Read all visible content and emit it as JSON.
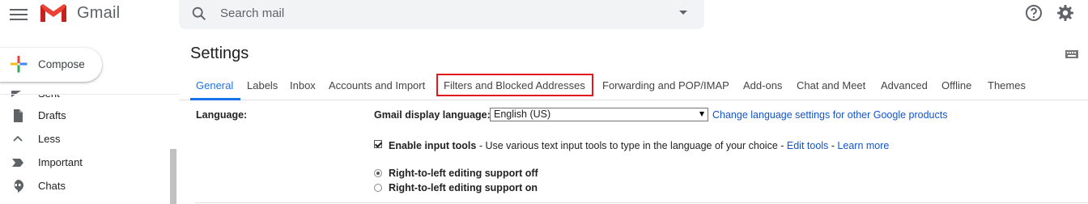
{
  "header": {
    "brand": "Gmail",
    "search_placeholder": "Search mail"
  },
  "sidebar": {
    "compose_label": "Compose",
    "cut_item_label": "Sent",
    "items": [
      {
        "label": "Drafts",
        "icon": "draft-icon"
      },
      {
        "label": "Less",
        "icon": "chevron-up-icon"
      },
      {
        "label": "Important",
        "icon": "important-icon"
      },
      {
        "label": "Chats",
        "icon": "chat-icon"
      }
    ]
  },
  "settings": {
    "title": "Settings",
    "tabs": [
      {
        "label": "General",
        "active": true
      },
      {
        "label": "Labels"
      },
      {
        "label": "Inbox"
      },
      {
        "label": "Accounts and Import"
      },
      {
        "label": "Filters and Blocked Addresses",
        "highlighted": true
      },
      {
        "label": "Forwarding and POP/IMAP"
      },
      {
        "label": "Add-ons"
      },
      {
        "label": "Chat and Meet"
      },
      {
        "label": "Advanced"
      },
      {
        "label": "Offline"
      },
      {
        "label": "Themes"
      }
    ],
    "language": {
      "label": "Language:",
      "display_language_label": "Gmail display language:",
      "selected_language": "English (US)",
      "change_link": "Change language settings for other Google products",
      "input_tools_bold": "Enable input tools",
      "input_tools_desc": " - Use various text input tools to type in the language of your choice - ",
      "edit_tools_link": "Edit tools",
      "separator": " - ",
      "learn_more_link": "Learn more",
      "input_tools_checked": true,
      "rtl_off_label": "Right-to-left editing support off",
      "rtl_on_label": "Right-to-left editing support on",
      "rtl_selected": "off"
    }
  },
  "colors": {
    "accent": "#1a73e8",
    "highlight_box": "#e0191e",
    "link": "#1155cc"
  }
}
